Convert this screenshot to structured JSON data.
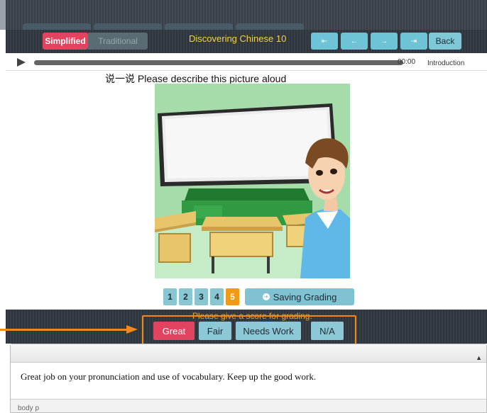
{
  "toolbar": {
    "simplified_label": "Simplified",
    "traditional_label": "Traditional",
    "title": "Discovering Chinese 10",
    "nav_first": "⇤",
    "nav_prev": "←",
    "nav_next": "→",
    "nav_last": "⇥",
    "back_label": "Back"
  },
  "player": {
    "time": "00:00",
    "section": "Introduction",
    "progress": 0
  },
  "prompt": "说一说 Please describe this picture aloud",
  "pager": {
    "pages": [
      "1",
      "2",
      "3",
      "4",
      "5"
    ],
    "active_page": "5",
    "saving_label": "Saving Grading"
  },
  "grading": {
    "prompt": "Please give a score for grading.",
    "options": [
      "Great",
      "Fair",
      "Needs Work",
      "N/A"
    ],
    "selected": "Great"
  },
  "editor": {
    "text": "Great job on your pronunciation and use of vocabulary. Keep up the good work.",
    "status_path": "body  p",
    "scroll_icon": "▲"
  },
  "colors": {
    "accent_red": "#e0445e",
    "accent_teal": "#7fc8d8",
    "active_orange": "#f29a17",
    "annotation_orange": "#f28a1b"
  }
}
